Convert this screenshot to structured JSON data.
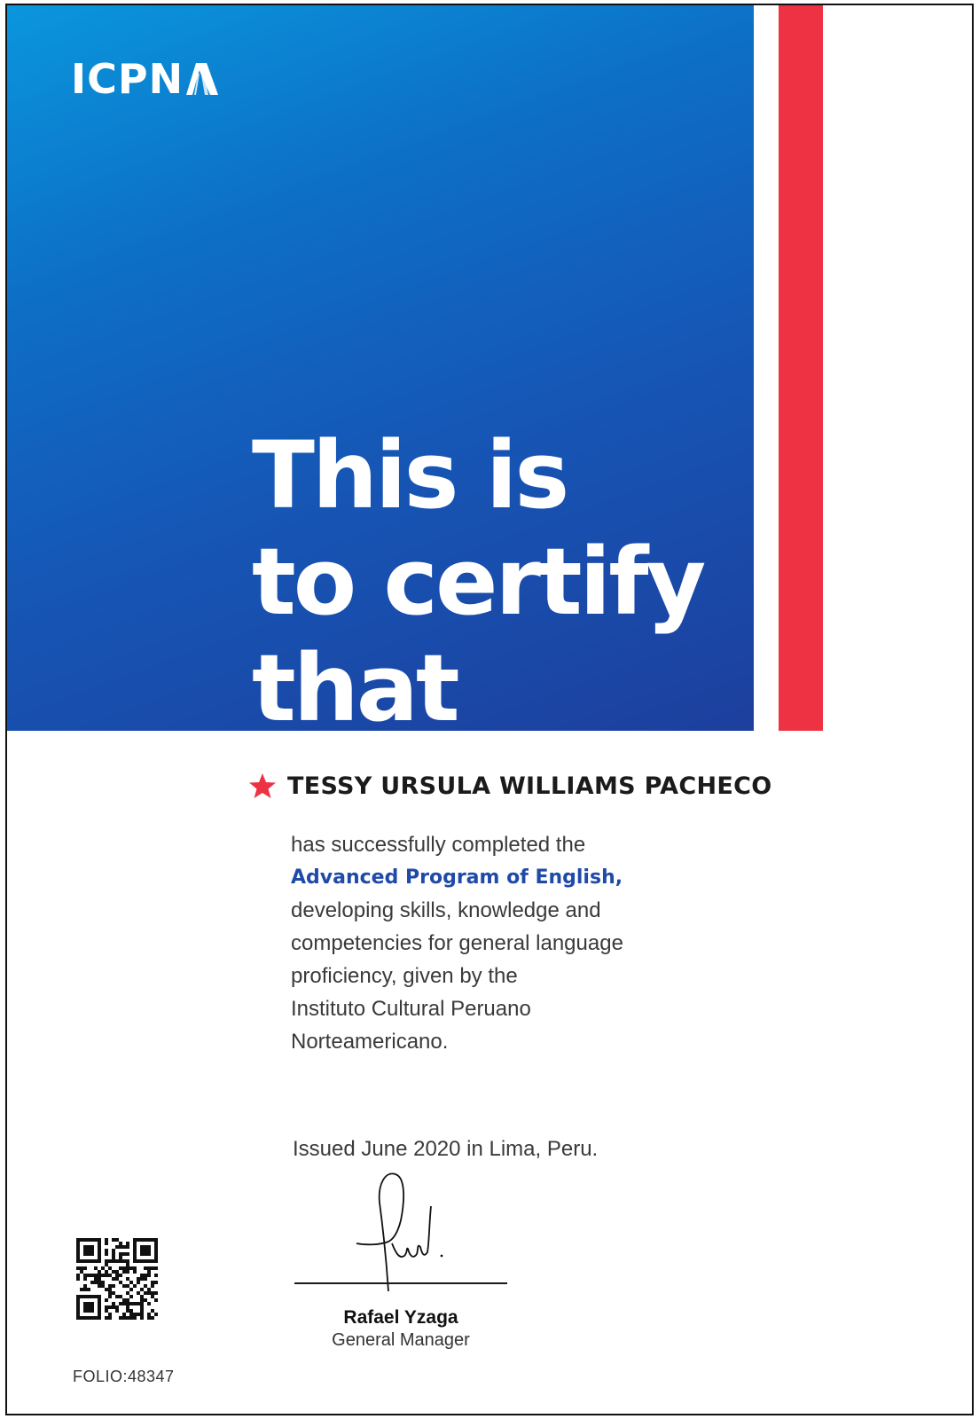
{
  "logo": {
    "text": "ICPN",
    "glyph": "A"
  },
  "headline": {
    "line1": "This is",
    "line2": "to certify",
    "line3": "that"
  },
  "recipient": {
    "name": "TESSY URSULA WILLIAMS PACHECO",
    "icon": "star-icon"
  },
  "body": {
    "line1": "has successfully completed the",
    "program": "Advanced Program of English,",
    "line3": "developing skills, knowledge and",
    "line4": "competencies for general language",
    "line5": "proficiency, given by the",
    "line6": "Instituto Cultural Peruano",
    "line7": "Norteamericano."
  },
  "issued": "Issued June 2020 in Lima, Peru.",
  "signer": {
    "name": "Rafael Yzaga",
    "role": "General Manager"
  },
  "folio": "FOLIO:48347",
  "colors": {
    "blue_start": "#0a96dc",
    "blue_end": "#1d3f9e",
    "red": "#ee3143",
    "program_blue": "#1f4aa8"
  }
}
